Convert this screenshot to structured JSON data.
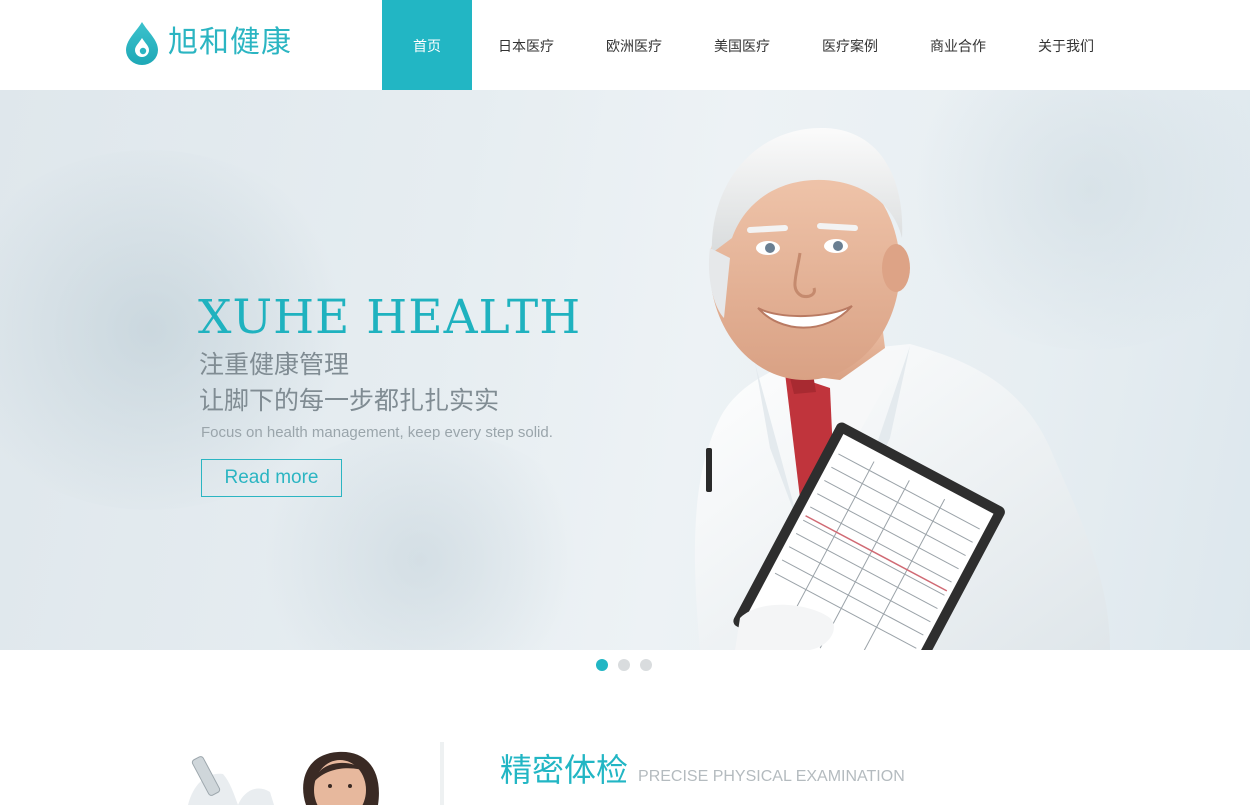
{
  "brand": {
    "name": "旭和健康",
    "accent_color": "#22b6c4",
    "logo_icon": "water-drop-icon"
  },
  "nav": {
    "items": [
      {
        "label": "首页",
        "active": true
      },
      {
        "label": "日本医疗",
        "active": false
      },
      {
        "label": "欧洲医疗",
        "active": false
      },
      {
        "label": "美国医疗",
        "active": false
      },
      {
        "label": "医疗案例",
        "active": false
      },
      {
        "label": "商业合作",
        "active": false
      },
      {
        "label": "关于我们",
        "active": false
      }
    ]
  },
  "hero": {
    "title": "XUHE HEALTH",
    "line1": "注重健康管理",
    "line2": "让脚下的每一步都扎扎实实",
    "subtitle": "Focus on health management, keep every step solid.",
    "button_label": "Read more",
    "image": "doctor-with-clipboard"
  },
  "carousel": {
    "slide_count": 3,
    "active_index": 0
  },
  "section": {
    "title_cn": "精密体检",
    "title_en": "PRECISE PHYSICAL EXAMINATION",
    "image": "lab-technician-with-test-tube"
  }
}
